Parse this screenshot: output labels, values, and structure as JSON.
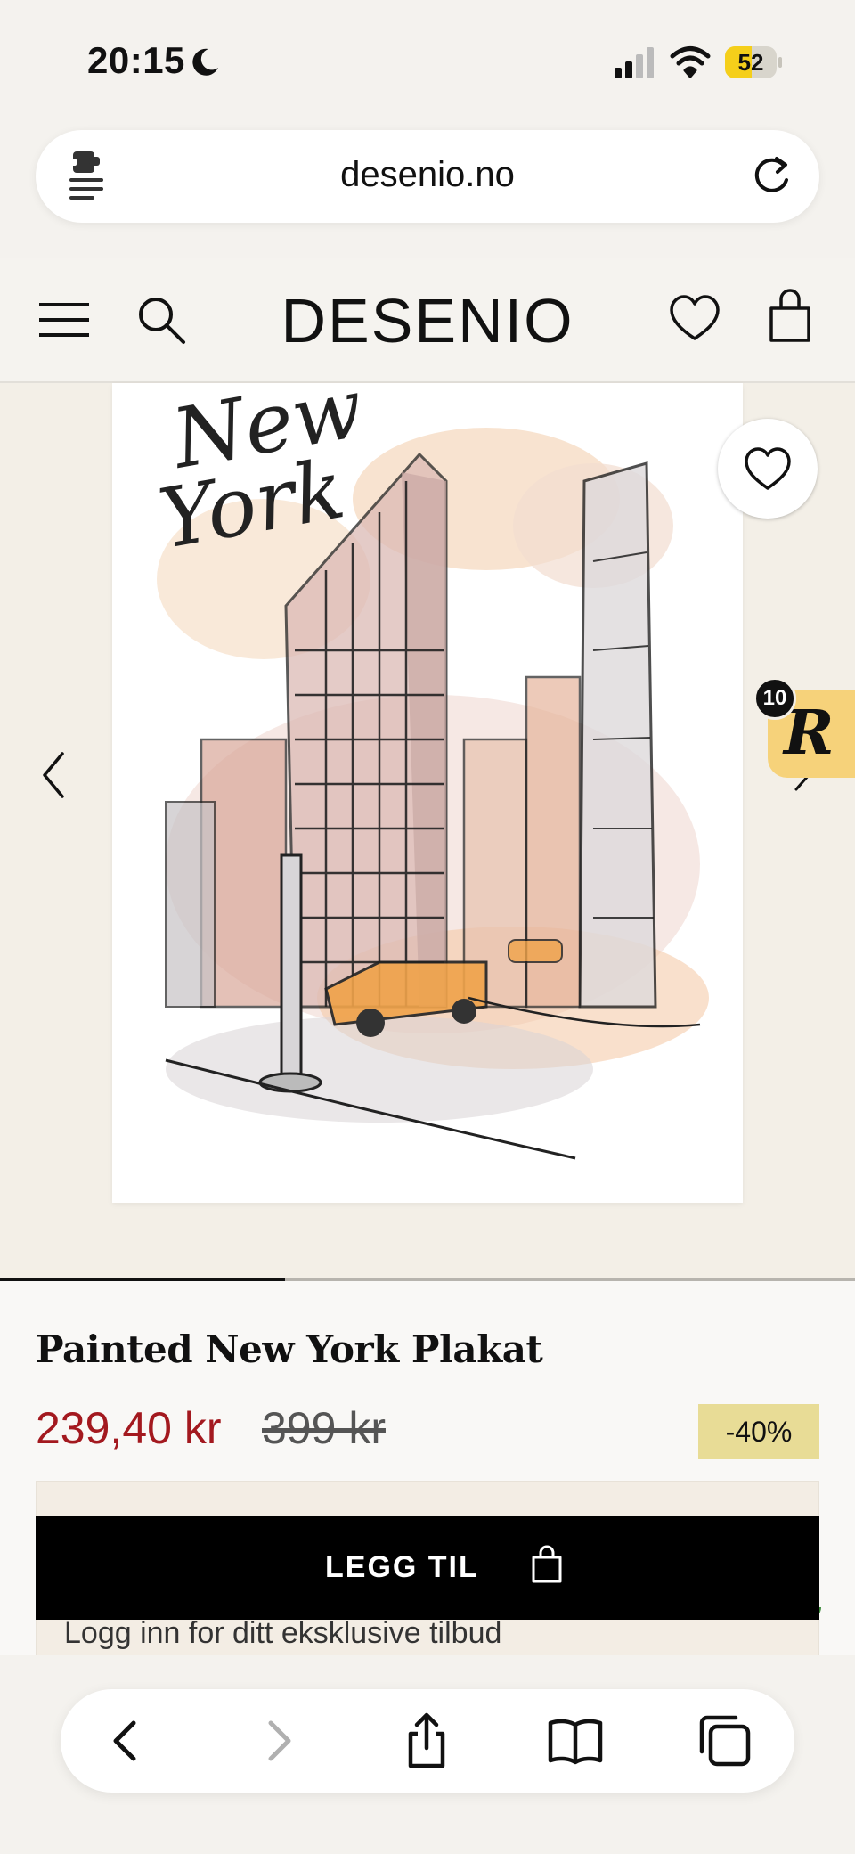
{
  "status_bar": {
    "time": "20:15",
    "battery": "52",
    "battery_level": 0.52,
    "icons": [
      "moon-icon",
      "signal-icon",
      "wifi-icon",
      "battery-icon"
    ]
  },
  "browser": {
    "url": "desenio.no",
    "icons": [
      "reader-icon",
      "reload-icon"
    ]
  },
  "header": {
    "logo": "DESENIO",
    "icons": [
      "menu-icon",
      "search-icon",
      "heart-icon",
      "bag-icon"
    ]
  },
  "product": {
    "poster_text": "New York",
    "title": "Painted New York Plakat",
    "price_sale": "239,40 kr",
    "price_original": "399 kr",
    "discount": "-40%",
    "offer_text": "Logg inn for ditt eksklusive tilbud",
    "add_to_cart": "LEGG TIL",
    "reward_count": "10",
    "gallery_position": 0.333
  },
  "colors": {
    "sale_price": "#a3191f",
    "discount_badge": "#e8dc96",
    "reward_widget": "#f6d27a",
    "cta_background": "#000000",
    "battery_fill": "#f5cf1a"
  },
  "bottom_toolbar": {
    "icons": [
      "back-icon",
      "forward-icon",
      "share-icon",
      "bookmarks-icon",
      "tabs-icon"
    ]
  }
}
